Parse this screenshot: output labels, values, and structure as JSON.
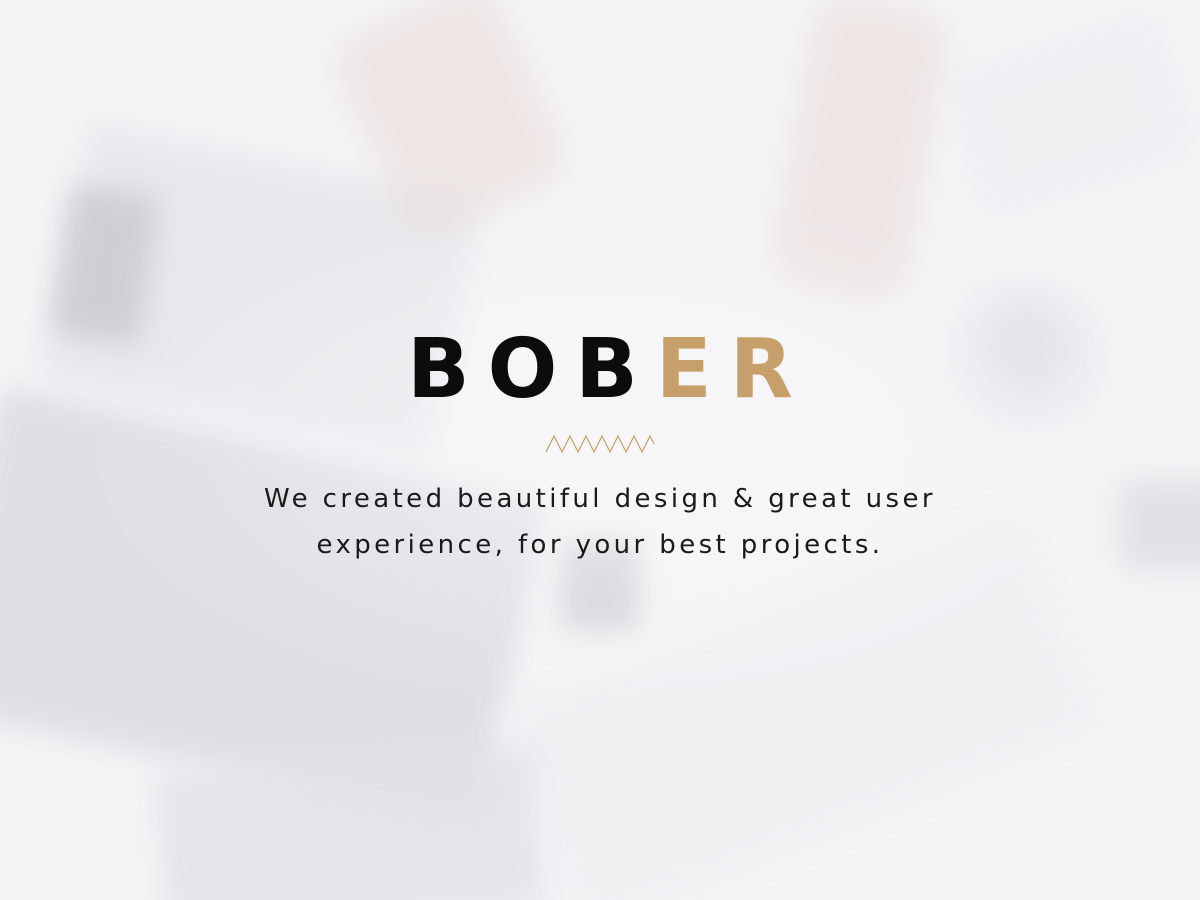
{
  "brand": {
    "part_dark": "BOB",
    "part_accent": "ER",
    "accent_color": "#c79f6b",
    "dark_color": "#0c0c0c"
  },
  "divider": {
    "icon": "zigzag-icon",
    "color": "#c79f6b"
  },
  "tagline": {
    "line1": "We created beautiful design & great user",
    "line2": "experience, for your best projects."
  },
  "background": {
    "base_color": "#f4f4f6"
  }
}
